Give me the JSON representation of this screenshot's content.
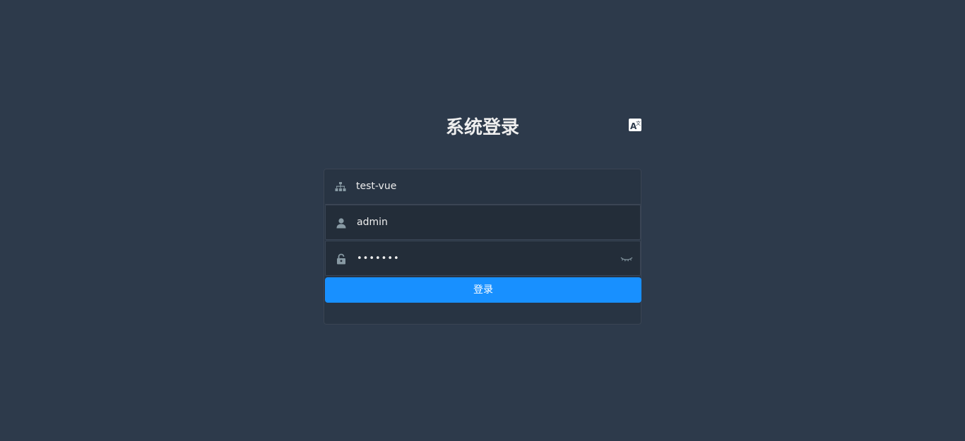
{
  "page": {
    "title": "系统登录"
  },
  "lang_button": {
    "icon": "translate-icon"
  },
  "form": {
    "tenant": {
      "value": "test-vue",
      "icon": "org-tree-icon"
    },
    "username": {
      "value": "admin",
      "icon": "user-icon"
    },
    "password": {
      "value": "1234567",
      "icon": "lock-icon",
      "toggle_icon": "eye-closed-icon"
    },
    "submit_label": "登录"
  },
  "colors": {
    "background": "#2d3a4b",
    "primary": "#1890ff",
    "text": "#eeeeee",
    "icon": "#889aa4"
  }
}
